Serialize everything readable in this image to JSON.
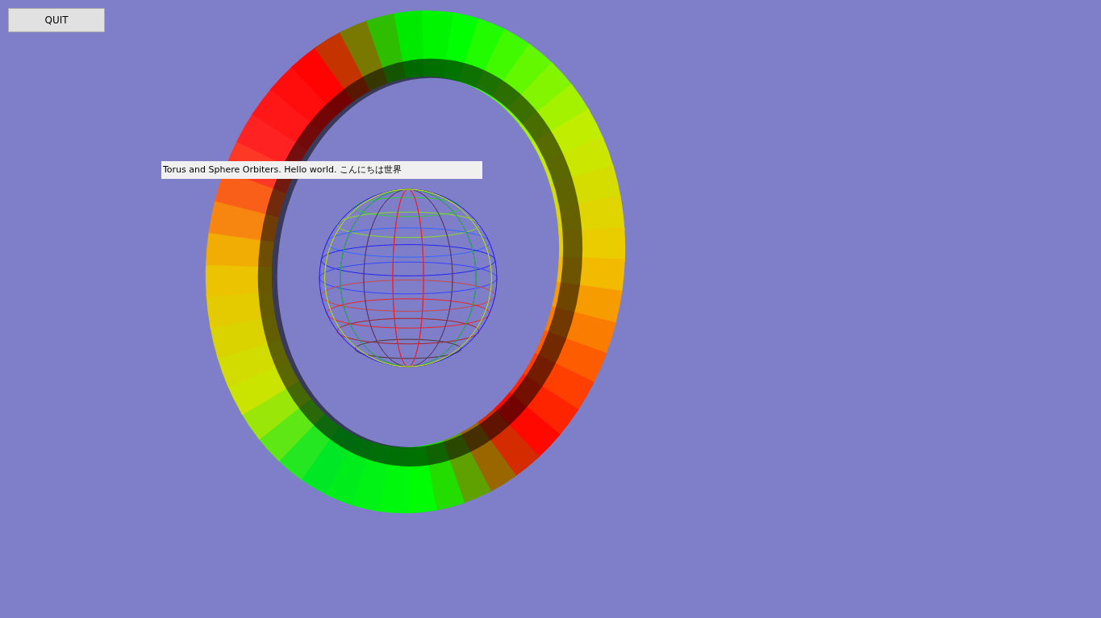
{
  "quit_button": {
    "label": "QUIT"
  },
  "caption": {
    "text": "Torus and Sphere Orbiters. Hello world. こんにちは世界"
  }
}
